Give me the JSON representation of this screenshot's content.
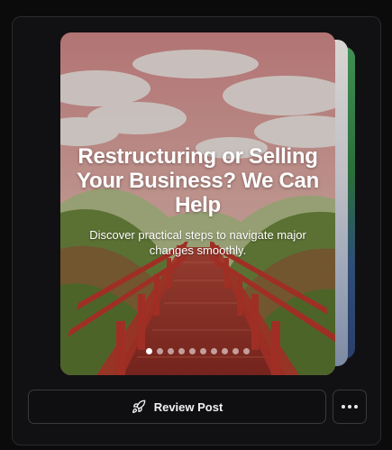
{
  "card": {
    "title": "Restructuring or Selling Your Business? We Can Help",
    "subtitle": "Discover practical steps to navigate major changes smoothly.",
    "slide_count": 10,
    "active_slide": 0
  },
  "actions": {
    "review_label": "Review Post",
    "review_icon": "rocket-icon",
    "more_icon": "more-horizontal-icon"
  },
  "colors": {
    "background": "#0b0b0c",
    "panel": "#111113",
    "border": "#3a3a3e",
    "bridge": "#c23a2e"
  }
}
